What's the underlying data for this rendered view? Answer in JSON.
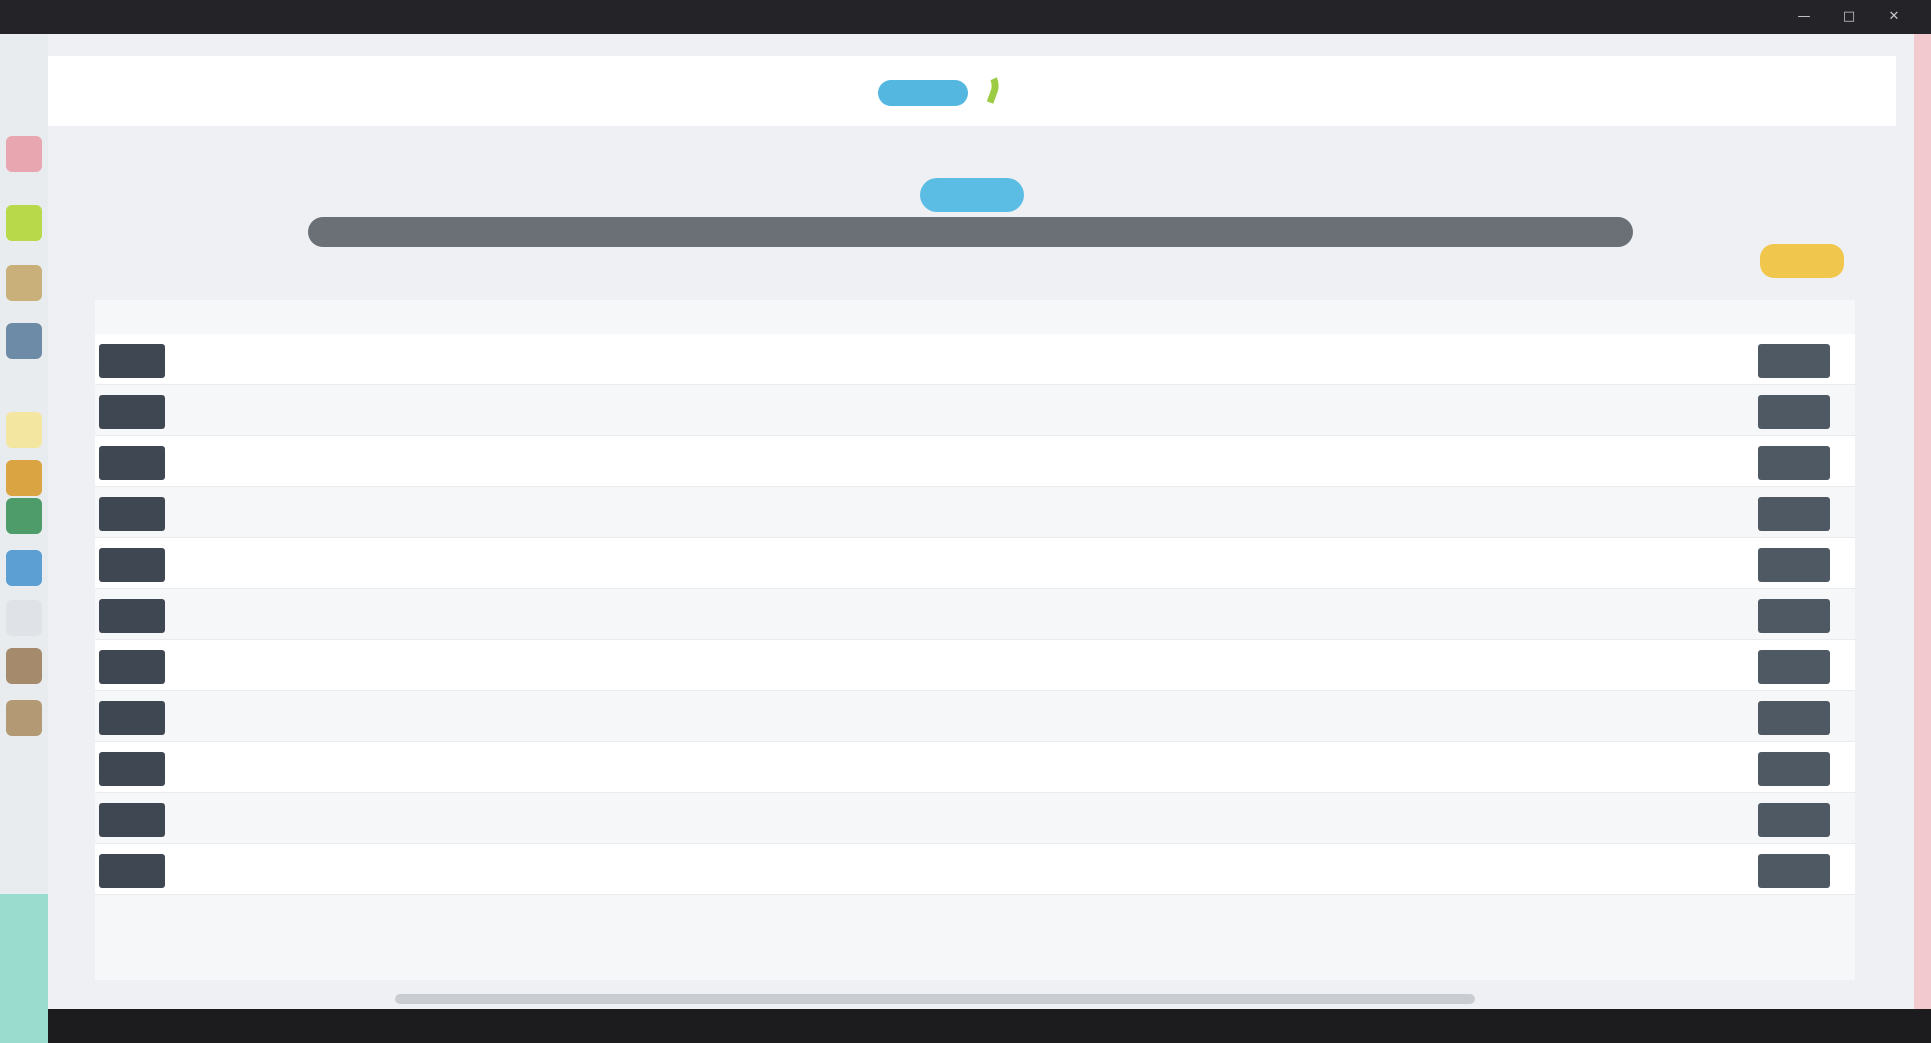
{
  "window": {
    "controls": [
      "—",
      "□",
      "✕"
    ]
  },
  "colors": {
    "header_bg": "#ffffff",
    "page_bg": "#eef0f3",
    "nav_bar": "#6a7076",
    "accent_blue": "#5bbde3",
    "accent_yellow": "#f0c64c",
    "action_dark": "#3f4852",
    "dock_teal": "#9adcce"
  },
  "dock": {
    "icons": [
      {
        "name": "app-icon-1",
        "color": "#e8a7b0"
      },
      {
        "name": "app-icon-2",
        "color": "#b7d94a"
      },
      {
        "name": "app-icon-3",
        "color": "#c9b07a"
      },
      {
        "name": "app-icon-4",
        "color": "#6d8aa6"
      },
      {
        "name": "app-icon-5",
        "color": "#f3e6a0"
      },
      {
        "name": "app-icon-6",
        "color": "#d9a441"
      },
      {
        "name": "app-icon-7",
        "color": "#4e9c6a"
      },
      {
        "name": "app-icon-8",
        "color": "#5b9fd3"
      },
      {
        "name": "app-icon-9",
        "color": "#dfe3e7"
      },
      {
        "name": "app-icon-10",
        "color": "#a58a6c"
      },
      {
        "name": "app-icon-11",
        "color": "#b39a74"
      }
    ]
  },
  "header": {
    "left_text": "",
    "right_text": "",
    "logo_icon": "brand-logo-icon"
  },
  "page": {
    "subtitle": "",
    "nav_items": []
  },
  "tabs": [
    "",
    ""
  ],
  "table": {
    "columns": [
      "",
      "",
      "",
      "",
      "",
      "",
      "",
      "",
      "",
      "",
      "",
      "",
      "",
      "",
      "",
      "",
      "",
      "",
      "",
      ""
    ],
    "rows": [
      {
        "cells": [
          "",
          "",
          "",
          "",
          ""
        ],
        "note": ""
      },
      {
        "cells": [
          "",
          "",
          "",
          "",
          ""
        ],
        "note": ""
      },
      {
        "cells": [
          "",
          "",
          "",
          "",
          ""
        ],
        "note": ""
      },
      {
        "cells": [
          "",
          "",
          "",
          "",
          ""
        ],
        "note": ""
      },
      {
        "cells": [
          "",
          "",
          "",
          "",
          ""
        ],
        "note": ""
      },
      {
        "cells": [
          "",
          "",
          "",
          "",
          ""
        ],
        "note": ""
      },
      {
        "cells": [
          "",
          "",
          "",
          "",
          ""
        ],
        "note": ""
      },
      {
        "cells": [
          "",
          "",
          "",
          "",
          ""
        ],
        "note": ""
      },
      {
        "cells": [
          "",
          "",
          "",
          "",
          ""
        ],
        "note": ""
      },
      {
        "cells": [
          "",
          "",
          "",
          "",
          ""
        ],
        "note": ""
      },
      {
        "cells": [
          "",
          "",
          "",
          "",
          ""
        ],
        "note": ""
      }
    ]
  }
}
